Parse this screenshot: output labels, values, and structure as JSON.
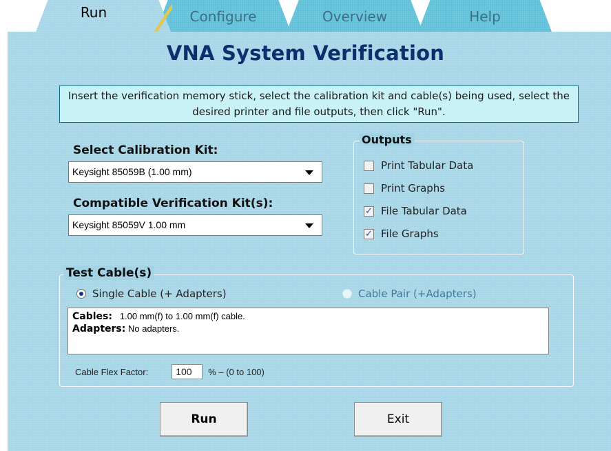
{
  "tabs": [
    {
      "label": "Run"
    },
    {
      "label": "Configure"
    },
    {
      "label": "Overview"
    },
    {
      "label": "Help"
    }
  ],
  "title": "VNA System Verification",
  "instructions": "Insert the verification memory stick, select the calibration kit and cable(s) being used, select the desired printer and file outputs, then click \"Run\".",
  "calibration": {
    "label": "Select Calibration Kit:",
    "selected": "Keysight 85059B (1.00 mm)"
  },
  "verification": {
    "label": "Compatible Verification Kit(s):",
    "selected": "Keysight 85059V 1.00 mm"
  },
  "outputs": {
    "legend": "Outputs",
    "items": [
      {
        "label": "Print Tabular Data",
        "checked": false
      },
      {
        "label": "Print Graphs",
        "checked": false
      },
      {
        "label": "File Tabular Data",
        "checked": true
      },
      {
        "label": "File Graphs",
        "checked": true
      }
    ],
    "check_mark": "✓"
  },
  "test_cables": {
    "legend": "Test Cable(s)",
    "single_label": "Single Cable (+ Adapters)",
    "pair_label": "Cable Pair (+Adapters)",
    "cables_key": "Cables:",
    "cables_value": "1.00 mm(f) to 1.00 mm(f) cable.",
    "adapters_key": "Adapters:",
    "adapters_value": "No adapters.",
    "flex_label": "Cable Flex Factor:",
    "flex_value": "100",
    "flex_unit": "%  – (0 to 100)"
  },
  "buttons": {
    "run": "Run",
    "exit": "Exit"
  }
}
